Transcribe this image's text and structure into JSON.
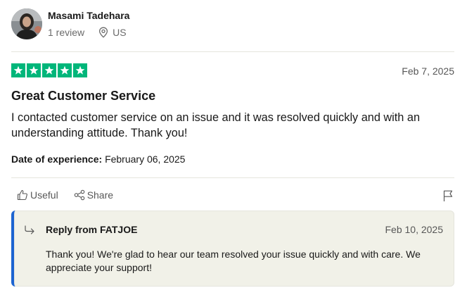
{
  "reviewer": {
    "name": "Masami Tadehara",
    "review_count": "1 review",
    "country": "US",
    "avatar_icon": "user-photo"
  },
  "review": {
    "rating": 5,
    "rating_max": 5,
    "star_color": "#00b67a",
    "date": "Feb 7, 2025",
    "title": "Great Customer Service",
    "body": "I contacted customer service on an issue and it was resolved quickly and with an understanding attitude. Thank you!",
    "experience_label": "Date of experience:",
    "experience_date": "February 06, 2025"
  },
  "actions": {
    "useful_label": "Useful",
    "share_label": "Share",
    "useful_icon": "thumbs-up-icon",
    "share_icon": "share-icon",
    "flag_icon": "flag-icon"
  },
  "reply": {
    "from": "Reply from FATJOE",
    "date": "Feb 10, 2025",
    "body": "Thank you! We're glad to hear our team resolved your issue quickly and with care. We appreciate your support!",
    "accent_color": "#1c64d1",
    "icon": "reply-arrow-icon"
  }
}
